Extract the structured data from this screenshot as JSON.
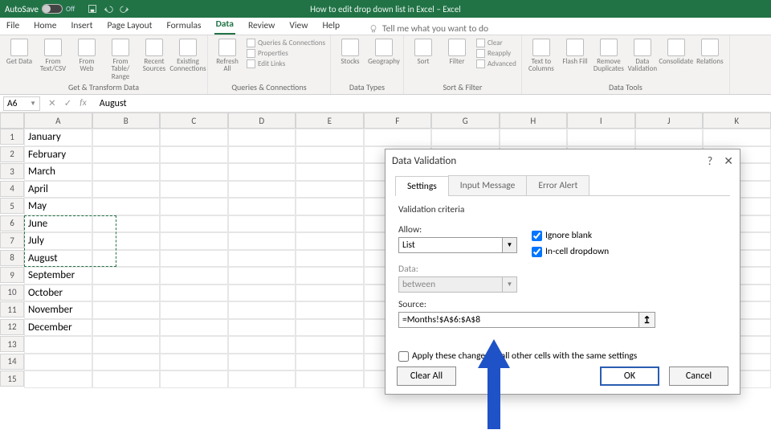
{
  "titlebar": {
    "autosave_label": "AutoSave",
    "autosave_state": "Off",
    "document_title": "How to edit drop down list in Excel – Excel"
  },
  "menu": {
    "tabs": [
      "File",
      "Home",
      "Insert",
      "Page Layout",
      "Formulas",
      "Data",
      "Review",
      "View",
      "Help"
    ],
    "active": "Data",
    "tellme_placeholder": "Tell me what you want to do"
  },
  "ribbon": {
    "groups": [
      {
        "label": "Get & Transform Data",
        "items": [
          {
            "label": "Get Data"
          },
          {
            "label": "From Text/CSV"
          },
          {
            "label": "From Web"
          },
          {
            "label": "From Table/ Range"
          },
          {
            "label": "Recent Sources"
          },
          {
            "label": "Existing Connections"
          }
        ]
      },
      {
        "label": "Queries & Connections",
        "master": {
          "label": "Refresh All"
        },
        "lines": [
          "Queries & Connections",
          "Properties",
          "Edit Links"
        ]
      },
      {
        "label": "Data Types",
        "items": [
          {
            "label": "Stocks"
          },
          {
            "label": "Geography"
          }
        ]
      },
      {
        "label": "Sort & Filter",
        "items": [
          {
            "label": "Sort"
          },
          {
            "label": "Filter"
          }
        ],
        "lines": [
          "Clear",
          "Reapply",
          "Advanced"
        ]
      },
      {
        "label": "Data Tools",
        "items": [
          {
            "label": "Text to Columns"
          },
          {
            "label": "Flash Fill"
          },
          {
            "label": "Remove Duplicates"
          },
          {
            "label": "Data Validation"
          },
          {
            "label": "Consolidate"
          },
          {
            "label": "Relations"
          }
        ]
      }
    ]
  },
  "namebox": {
    "value": "A6"
  },
  "formula": {
    "value": "August"
  },
  "columns": [
    "A",
    "B",
    "C",
    "D",
    "E",
    "F",
    "G",
    "H",
    "I",
    "J",
    "K"
  ],
  "rows_visible": 15,
  "cellsA": [
    "January",
    "February",
    "March",
    "April",
    "May",
    "June",
    "July",
    "August",
    "September",
    "October",
    "November",
    "December",
    "",
    "",
    ""
  ],
  "cursor_overlay_row": 8,
  "marquee": {
    "row_start": 6,
    "row_end": 8
  },
  "dialog": {
    "title": "Data Validation",
    "tabs": [
      "Settings",
      "Input Message",
      "Error Alert"
    ],
    "active_tab": "Settings",
    "criteria_label": "Validation criteria",
    "allow_label": "Allow:",
    "allow_value": "List",
    "data_label": "Data:",
    "data_value": "between",
    "source_label": "Source:",
    "source_value": "=Months!$A$6:$A$8",
    "ignore_blank_label": "Ignore blank",
    "ignore_blank_checked": true,
    "incell_label": "In-cell dropdown",
    "incell_checked": true,
    "apply_label": "Apply these changes to all other cells with the same settings",
    "apply_checked": false,
    "clear_all": "Clear All",
    "ok": "OK",
    "cancel": "Cancel"
  }
}
